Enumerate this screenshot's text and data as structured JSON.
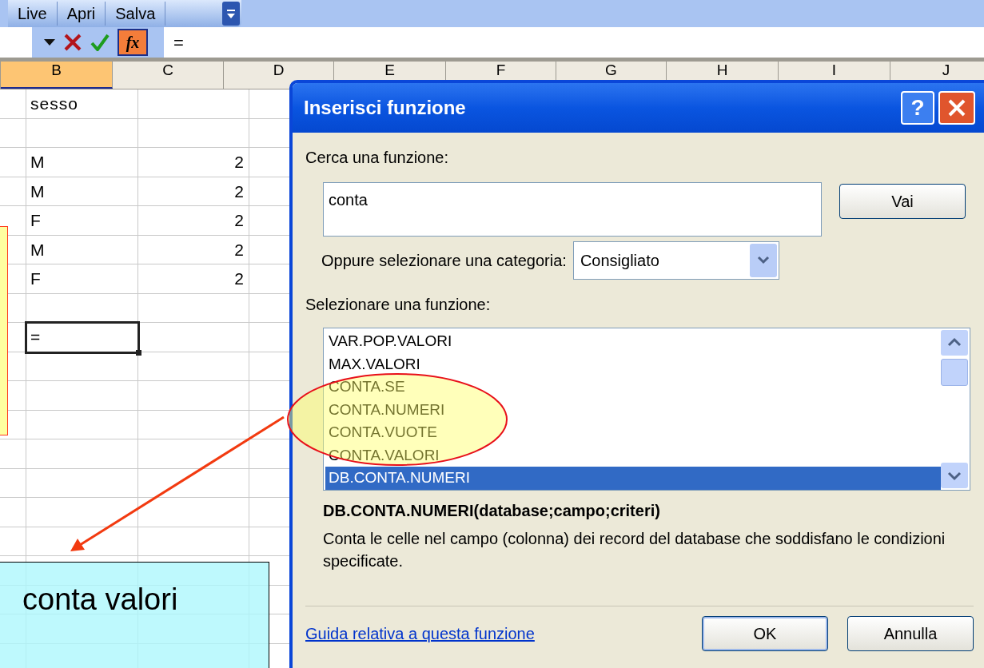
{
  "toolbar": {
    "buttons": [
      "Live",
      "Apri",
      "Salva"
    ]
  },
  "formula_bar": {
    "fx_label": "fx",
    "value": "="
  },
  "sheet": {
    "columns": [
      {
        "label": "B",
        "selected": true
      },
      {
        "label": "C",
        "selected": false
      },
      {
        "label": "D",
        "selected": false
      },
      {
        "label": "E",
        "selected": false
      },
      {
        "label": "F",
        "selected": false
      },
      {
        "label": "G",
        "selected": false
      },
      {
        "label": "H",
        "selected": false
      },
      {
        "label": "I",
        "selected": false
      },
      {
        "label": "J",
        "selected": false
      }
    ],
    "rows": [
      {
        "b": "sesso",
        "active": false
      },
      {
        "active": false
      },
      {
        "b": "M",
        "c": "2",
        "active": false
      },
      {
        "b": "M",
        "c": "2",
        "active": false
      },
      {
        "b": "F",
        "c": "2",
        "active": false
      },
      {
        "b": "M",
        "c": "2",
        "active": false
      },
      {
        "b": "F",
        "c": "2",
        "active": false
      },
      {
        "active": false
      },
      {
        "b": "=",
        "active": true
      }
    ]
  },
  "dialog": {
    "title": "Inserisci funzione",
    "help_label": "?",
    "search_label": "Cerca una funzione:",
    "search_value": "conta",
    "go_button": "Vai",
    "category_label": "Oppure selezionare una categoria:",
    "category_value": "Consigliato",
    "function_label": "Selezionare una funzione:",
    "functions": [
      {
        "label": "VAR.POP.VALORI",
        "selected": false
      },
      {
        "label": "MAX.VALORI",
        "selected": false
      },
      {
        "label": "CONTA.SE",
        "selected": false
      },
      {
        "label": "CONTA.NUMERI",
        "selected": false
      },
      {
        "label": "CONTA.VUOTE",
        "selected": false
      },
      {
        "label": "CONTA.VALORI",
        "selected": false
      },
      {
        "label": "DB.CONTA.NUMERI",
        "selected": true
      }
    ],
    "signature": "DB.CONTA.NUMERI(database;campo;criteri)",
    "description": "Conta le celle nel campo (colonna) dei record del database che soddisfano le condizioni specificate.",
    "help_link": "Guida relativa a questa funzione",
    "buttons": [
      "OK",
      "Annulla"
    ]
  },
  "callout": {
    "text": "conta valori"
  }
}
